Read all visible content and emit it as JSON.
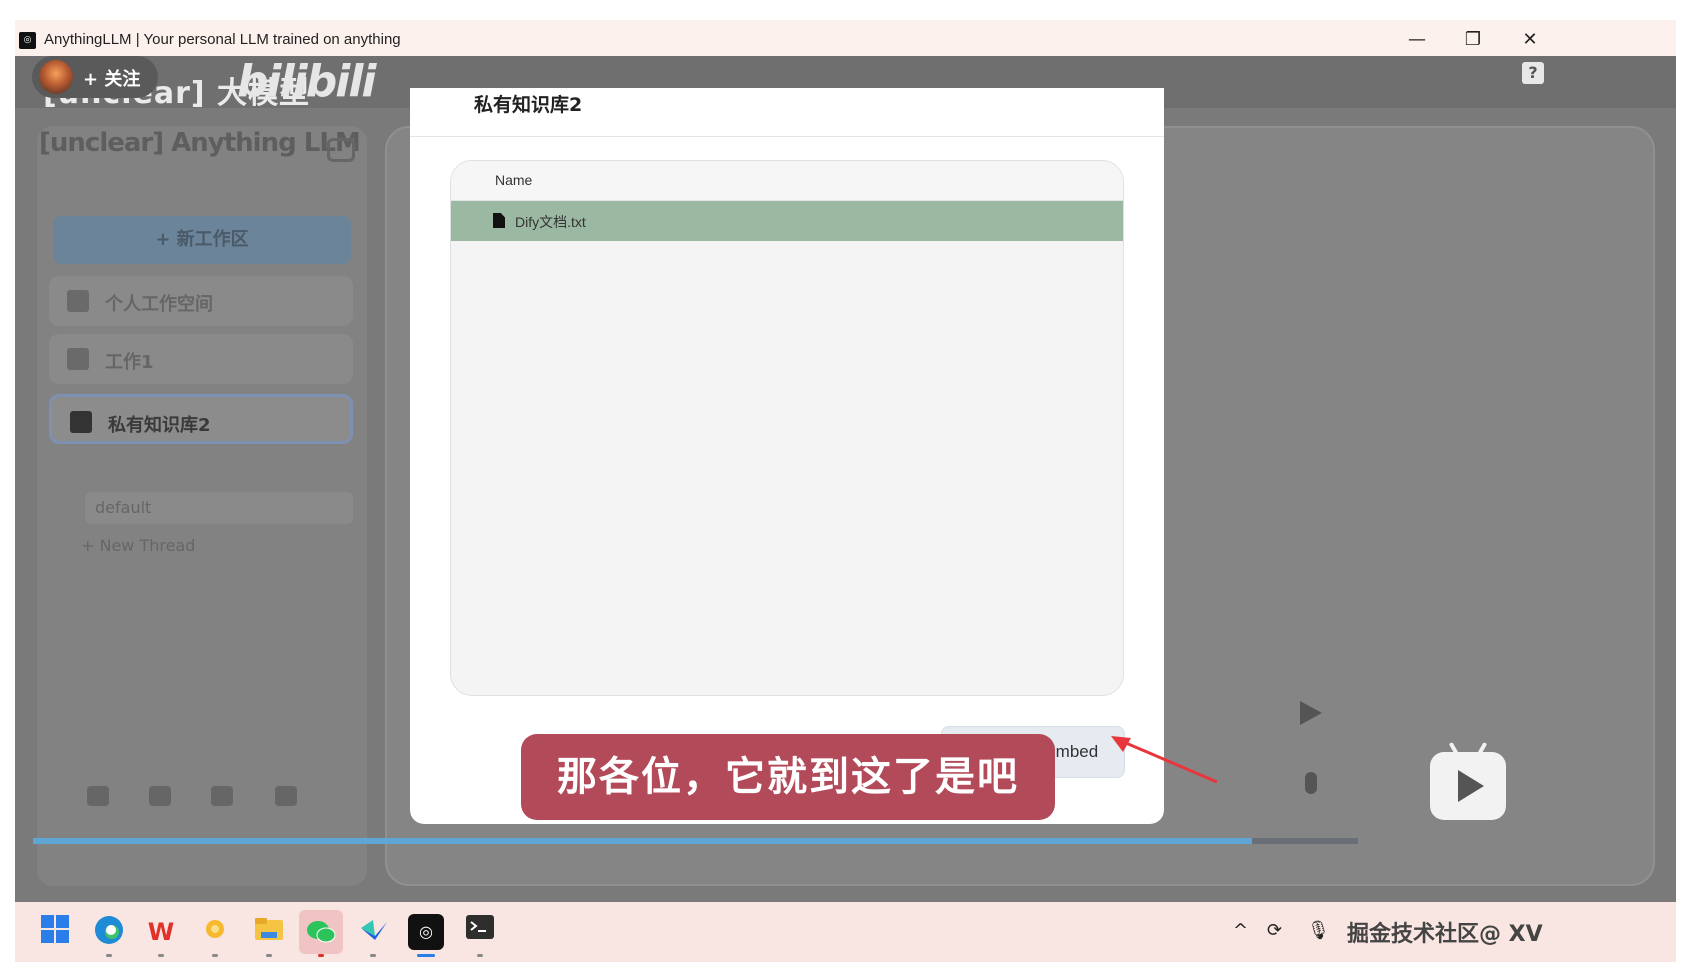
{
  "window": {
    "title": "AnythingLLM | Your personal LLM trained on anything",
    "controls": {
      "minimize": "—",
      "maximize": "❐",
      "close": "✕"
    }
  },
  "video_overlay": {
    "follow_label": "+ 关注",
    "channel_name": "[unclear] 大模型",
    "platform_logo": "bilibili",
    "subtitle": "那各位，它就到这了是吧",
    "progress_fraction": 0.92
  },
  "app": {
    "logo": "[unclear] Anything LLM",
    "new_workspace_label": "+ 新工作区",
    "workspaces": [
      {
        "label": "个人工作空间",
        "active": false
      },
      {
        "label": "工作1",
        "active": false
      },
      {
        "label": "私有知识库2",
        "active": true
      }
    ],
    "threads": {
      "default_label": "default",
      "new_thread_label": "+ New Thread"
    },
    "help_icon": "?"
  },
  "modal": {
    "title": "私有知识库2",
    "table": {
      "column_name": "Name",
      "rows": [
        {
          "name": "Dify文档.txt"
        }
      ]
    },
    "save_button_label": "Save and Embed"
  },
  "taskbar": {
    "watermark": "掘金技术社区@ XV",
    "tray_chevron": "^"
  },
  "colors": {
    "selected_row": "#9bb9a2",
    "subtitle_bg": "#b34a5a",
    "annotation_arrow": "#e8363c",
    "progress": "#5fa6d4"
  }
}
